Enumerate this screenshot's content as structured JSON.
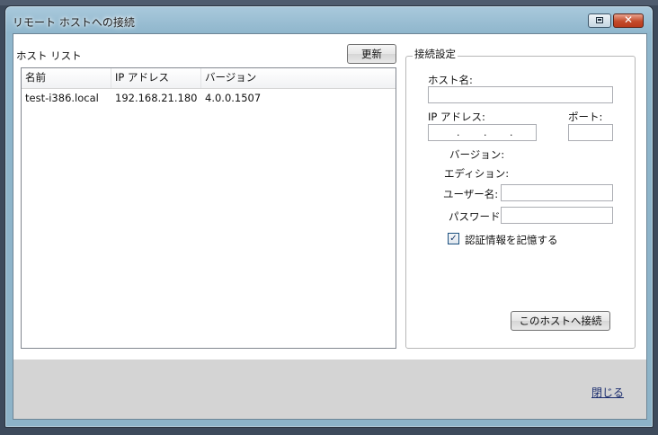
{
  "window": {
    "title": "リモート ホストへの接続",
    "restore_icon": "restore-icon",
    "close_icon": "close-icon"
  },
  "host_list": {
    "label": "ホスト リスト",
    "refresh_label": "更新",
    "columns": [
      "名前",
      "IP アドレス",
      "バージョン"
    ],
    "rows": [
      {
        "name": "test-i386.local",
        "ip": "192.168.21.180",
        "version": "4.0.0.1507"
      }
    ]
  },
  "connection_settings": {
    "legend": "接続設定",
    "host_name_label": "ホスト名:",
    "host_name_value": "",
    "ip_label": "IP アドレス:",
    "ip_separator": ".",
    "port_label": "ポート:",
    "port_value": "",
    "version_label": "バージョン:",
    "edition_label": "エディション:",
    "user_label": "ユーザー名:",
    "user_value": "",
    "password_label": "パスワード:",
    "password_value": "",
    "remember_label": "認証情報を記憶する",
    "remember_checked": true,
    "check_mark": "✓",
    "connect_label": "このホストへ接続"
  },
  "footer": {
    "close_label": "閉じる"
  },
  "colors": {
    "titlebar": "#8fb6cc",
    "close_button": "#c44a2a",
    "footer_background": "#d4d4d4"
  }
}
